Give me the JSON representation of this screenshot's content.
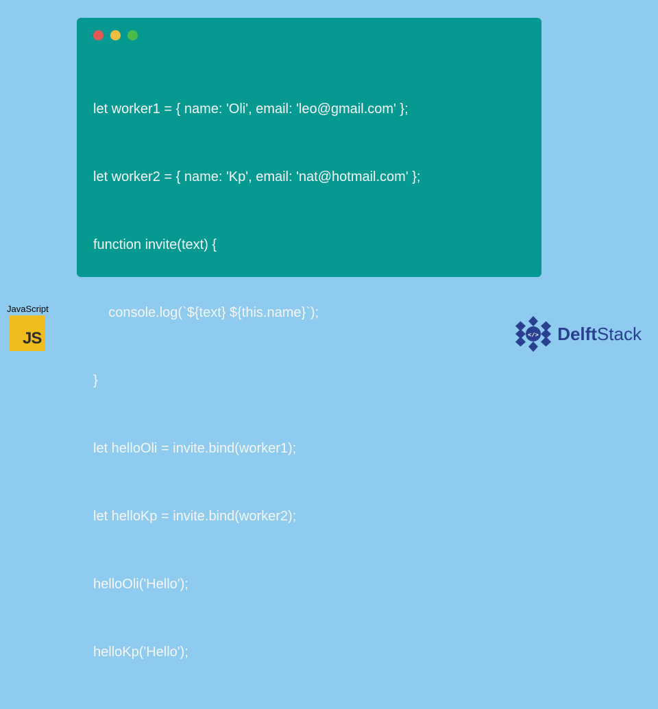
{
  "code": {
    "lines": [
      "let worker1 = { name: 'Oli', email: 'leo@gmail.com' };",
      "let worker2 = { name: 'Kp', email: 'nat@hotmail.com' };",
      "function invite(text) {",
      "    console.log(`${text} ${this.name}`);",
      "}",
      "let helloOli = invite.bind(worker1);",
      "let helloKp = invite.bind(worker2);",
      "helloOli('Hello');",
      "helloKp('Hello');"
    ]
  },
  "badges": {
    "js_label": "JavaScript",
    "js_logo_text": "JS",
    "delft_bold": "Delft",
    "delft_rest": "Stack"
  }
}
